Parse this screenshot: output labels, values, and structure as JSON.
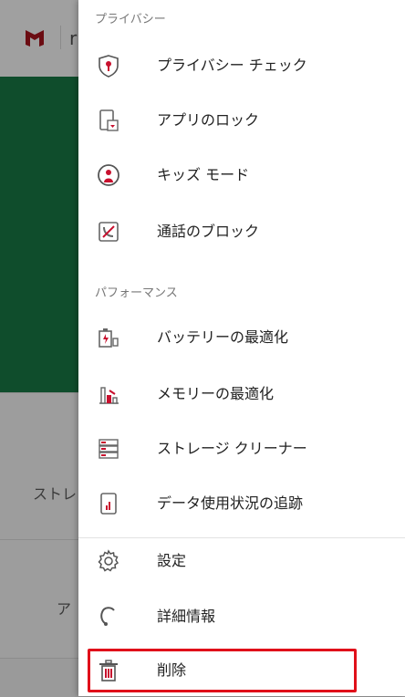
{
  "background": {
    "topbar_text": "r",
    "card1_text": "ストレ",
    "card2_text": "ア"
  },
  "drawer": {
    "privacy_header": "プライバシー",
    "performance_header": "パフォーマンス",
    "items": [
      {
        "label": "プライバシー チェック",
        "icon": "shield-lock-icon"
      },
      {
        "label": "アプリのロック",
        "icon": "app-lock-icon"
      },
      {
        "label": "キッズ モード",
        "icon": "kids-mode-icon"
      },
      {
        "label": "通話のブロック",
        "icon": "call-block-icon"
      },
      {
        "label": "バッテリーの最適化",
        "icon": "battery-icon"
      },
      {
        "label": "メモリーの最適化",
        "icon": "memory-icon"
      },
      {
        "label": "ストレージ クリーナー",
        "icon": "storage-icon"
      },
      {
        "label": "データ使用状況の追跡",
        "icon": "data-usage-icon"
      },
      {
        "label": "設定",
        "icon": "gear-icon"
      },
      {
        "label": "詳細情報",
        "icon": "support-headset-icon"
      },
      {
        "label": "削除",
        "icon": "trash-icon"
      }
    ]
  },
  "colors": {
    "accent_red": "#c8102e",
    "highlight_red": "#e0101a",
    "hero_green": "#0f4d2c"
  }
}
